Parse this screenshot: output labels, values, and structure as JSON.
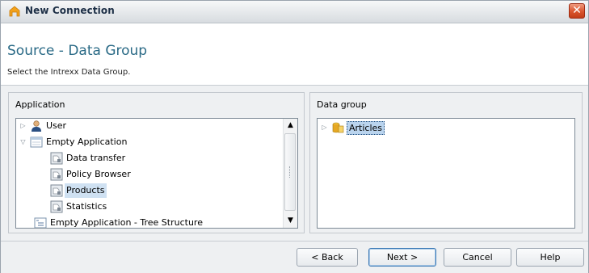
{
  "window": {
    "title": "New Connection",
    "close_symbol": "✕",
    "icons": {
      "app": "app-logo-icon",
      "close": "close-icon"
    }
  },
  "header": {
    "title": "Source - Data Group",
    "subtitle": "Select the Intrexx Data Group."
  },
  "application_panel": {
    "label": "Application",
    "tree": [
      {
        "label": "User",
        "icon": "user-icon",
        "expander": "collapsed"
      },
      {
        "label": "Empty Application",
        "icon": "application-icon",
        "expander": "expanded"
      },
      {
        "label": "Data transfer",
        "icon": "page-icon"
      },
      {
        "label": "Policy Browser",
        "icon": "page-icon"
      },
      {
        "label": "Products",
        "icon": "page-icon",
        "selected": true
      },
      {
        "label": "Statistics",
        "icon": "page-icon"
      },
      {
        "label": "Empty Application - Tree Structure",
        "icon": "tree-application-icon"
      }
    ],
    "scrollbar": {
      "up": "▲",
      "down": "▼"
    }
  },
  "data_group_panel": {
    "label": "Data group",
    "tree": [
      {
        "label": "Articles",
        "icon": "database-icon",
        "expander": "collapsed",
        "selected": true
      }
    ]
  },
  "footer": {
    "back": "< Back",
    "next": "Next >",
    "cancel": "Cancel",
    "help": "Help"
  },
  "colors": {
    "header_title": "#2a6a86",
    "selection": "#cfe1f2",
    "close_button": "#d9542d"
  }
}
